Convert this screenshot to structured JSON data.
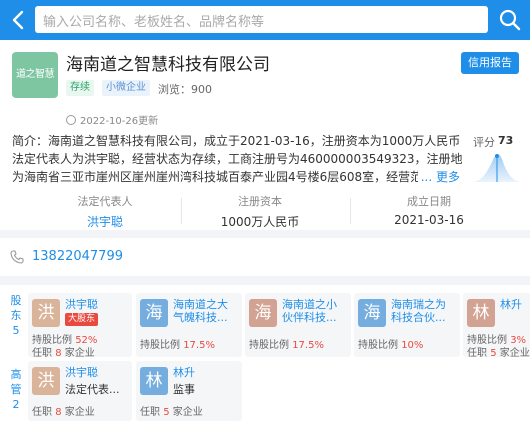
{
  "search": {
    "placeholder": "输入公司名称、老板姓名、品牌名称等"
  },
  "company": {
    "logo_text": "道之智慧",
    "name": "海南道之智慧科技有限公司",
    "report_button": "信用报告",
    "tag_status": "存续",
    "tag_size": "小微企业",
    "views": "浏览：900",
    "updated": "2022-10-26更新",
    "intro_lines": [
      "简介：海南道之智慧科技有限公司，成立于2021-03-16，注册资本为1000万人民币，",
      "法定代表人为洪宇聪，经营状态为存续，工商注册号为460000003549323，注册地址",
      "为海南省三亚市崖州区崖州崖州湾科技城百泰产业园4号楼6层608室，经营范围"
    ],
    "more": "... 更多",
    "score_label": "评分",
    "score_value": "73",
    "legal_rep_label": "法定代表人",
    "legal_rep_value": "洪宇聪",
    "capital_label": "注册资本",
    "capital_value": "1000万人民币",
    "founded_label": "成立日期",
    "founded_value": "2021-03-16",
    "phone": "13822047799"
  },
  "shareholders": {
    "label": [
      "股",
      "东",
      "5"
    ],
    "items": [
      {
        "avatar": "洪",
        "color": "#d9b49a",
        "name": "洪宇聪",
        "badge": "大股东",
        "ratio_label": "持股比例 ",
        "ratio": "52%",
        "role_label": "任职 ",
        "role_count": "8",
        "role_unit": " 家企业"
      },
      {
        "avatar": "海",
        "color": "#75aede",
        "name": "海南道之大",
        "name2": "气魄科技...",
        "ratio_label": "持股比例 ",
        "ratio": "17.5%"
      },
      {
        "avatar": "海",
        "color": "#d2a293",
        "name": "海南道之小",
        "name2": "伙伴科技...",
        "ratio_label": "持股比例 ",
        "ratio": "17.5%"
      },
      {
        "avatar": "海",
        "color": "#75aede",
        "name": "海南瑞之为",
        "name2": "科技合伙...",
        "ratio_label": "持股比例 ",
        "ratio": "10%"
      },
      {
        "avatar": "林",
        "color": "#d2a293",
        "name": "林升",
        "ratio_label": "持股比例 ",
        "ratio": "3%",
        "role_label": "任职 ",
        "role_count": "5",
        "role_unit": " 家企业"
      }
    ]
  },
  "executives": {
    "label": [
      "高",
      "管",
      "2"
    ],
    "items": [
      {
        "avatar": "洪",
        "color": "#d9b49a",
        "name": "洪宇聪",
        "position": "法定代表...",
        "role_label": "任职 ",
        "role_count": "8",
        "role_unit": " 家企业"
      },
      {
        "avatar": "林",
        "color": "#75aede",
        "name": "林升",
        "position": "监事",
        "role_label": "任职 ",
        "role_count": "5",
        "role_unit": " 家企业"
      }
    ]
  },
  "colors": {
    "accent": "#1e8ee8",
    "danger": "#e94a3f",
    "status_green": "#2da168"
  },
  "icons": {
    "back": "chevron-left-icon",
    "search": "search-icon",
    "phone": "phone-icon",
    "clock": "clock-icon"
  }
}
